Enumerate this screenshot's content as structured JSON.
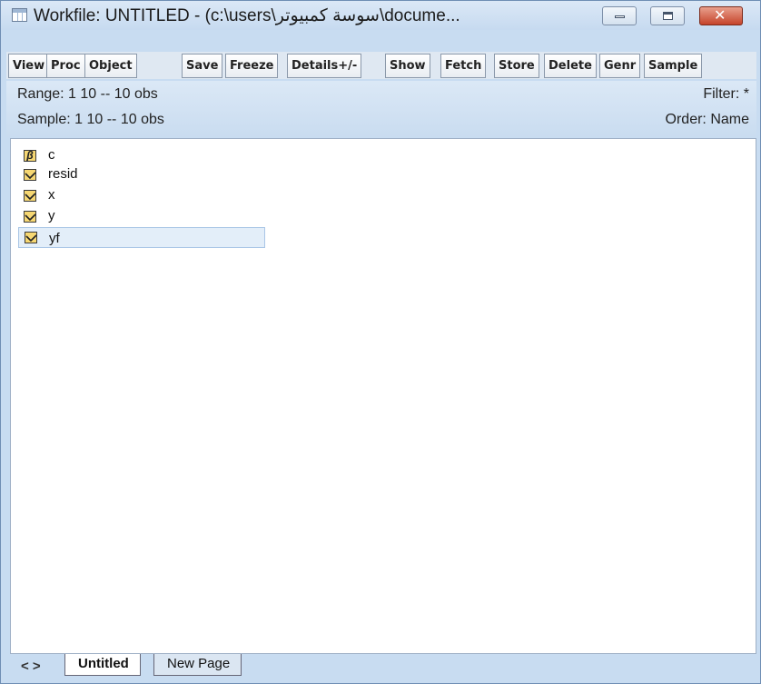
{
  "window": {
    "title": "Workfile: UNTITLED - (c:\\users\\سوسة كمبيوتر\\docume...",
    "buttons": {
      "minimize": "",
      "maximize": "",
      "close": "✕"
    }
  },
  "toolbar": {
    "buttons": [
      "View",
      "Proc",
      "Object",
      "Save",
      "Freeze",
      "Details+/-",
      "Show",
      "Fetch",
      "Store",
      "Delete",
      "Genr",
      "Sample"
    ]
  },
  "info": {
    "range": "Range:  1 10  --  10 obs",
    "sample": "Sample: 1 10  --  10 obs",
    "filter": "Filter: *",
    "order": "Order: Name"
  },
  "objects": [
    {
      "name": "c",
      "icon": "coefficient-icon",
      "selected": false
    },
    {
      "name": "resid",
      "icon": "series-icon",
      "selected": false
    },
    {
      "name": "x",
      "icon": "series-icon",
      "selected": false
    },
    {
      "name": "y",
      "icon": "series-icon",
      "selected": false
    },
    {
      "name": "yf",
      "icon": "series-icon",
      "selected": true
    }
  ],
  "tabs": {
    "nav": "< >",
    "pages": [
      "Untitled",
      "New Page"
    ]
  }
}
